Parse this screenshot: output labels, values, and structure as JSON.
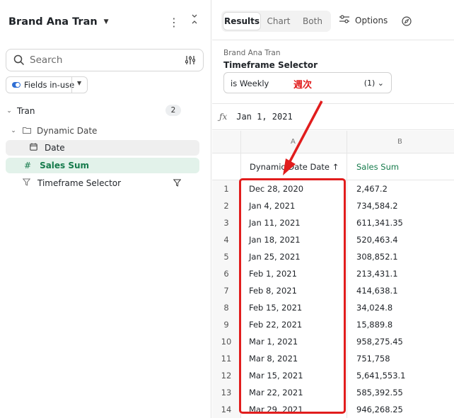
{
  "left_panel": {
    "title": "Brand Ana Tran",
    "search_placeholder": "Search",
    "chip_label": "Fields in-use",
    "tree": {
      "root": {
        "label": "Tran",
        "count": "2"
      },
      "group": {
        "label": "Dynamic Date"
      },
      "date_field": {
        "label": "Date"
      },
      "sales_field": {
        "label": "Sales Sum"
      },
      "timeframe_field": {
        "label": "Timeframe Selector"
      }
    }
  },
  "right_panel": {
    "tabs": [
      "Results",
      "Chart",
      "Both"
    ],
    "active_tab": "Results",
    "options_label": "Options",
    "selector": {
      "parent": "Brand Ana Tran",
      "title": "Timeframe Selector",
      "value": "is Weekly",
      "annotation": "週次",
      "count": "(1)"
    },
    "formula": "Jan 1, 2021",
    "columns": {
      "a_letter": "A",
      "b_letter": "B",
      "a_header": "Dynamic Date Date",
      "b_header": "Sales Sum",
      "sort_indicator": "↑"
    },
    "rows": [
      {
        "n": "1",
        "date": "Dec 28, 2020",
        "sales": "2,467.2"
      },
      {
        "n": "2",
        "date": "Jan 4, 2021",
        "sales": "734,584.2"
      },
      {
        "n": "3",
        "date": "Jan 11, 2021",
        "sales": "611,341.35"
      },
      {
        "n": "4",
        "date": "Jan 18, 2021",
        "sales": "520,463.4"
      },
      {
        "n": "5",
        "date": "Jan 25, 2021",
        "sales": "308,852.1"
      },
      {
        "n": "6",
        "date": "Feb 1, 2021",
        "sales": "213,431.1"
      },
      {
        "n": "7",
        "date": "Feb 8, 2021",
        "sales": "414,638.1"
      },
      {
        "n": "8",
        "date": "Feb 15, 2021",
        "sales": "34,024.8"
      },
      {
        "n": "9",
        "date": "Feb 22, 2021",
        "sales": "15,889.8"
      },
      {
        "n": "10",
        "date": "Mar 1, 2021",
        "sales": "958,275.45"
      },
      {
        "n": "11",
        "date": "Mar 8, 2021",
        "sales": "751,758"
      },
      {
        "n": "12",
        "date": "Mar 15, 2021",
        "sales": "5,641,553.1"
      },
      {
        "n": "13",
        "date": "Mar 22, 2021",
        "sales": "585,392.55"
      },
      {
        "n": "14",
        "date": "Mar 29, 2021",
        "sales": "946,268.25"
      }
    ]
  },
  "colors": {
    "accent_green": "#167b4c",
    "annotation_red": "#e11d1d",
    "toggle_blue": "#2f6fd4"
  }
}
